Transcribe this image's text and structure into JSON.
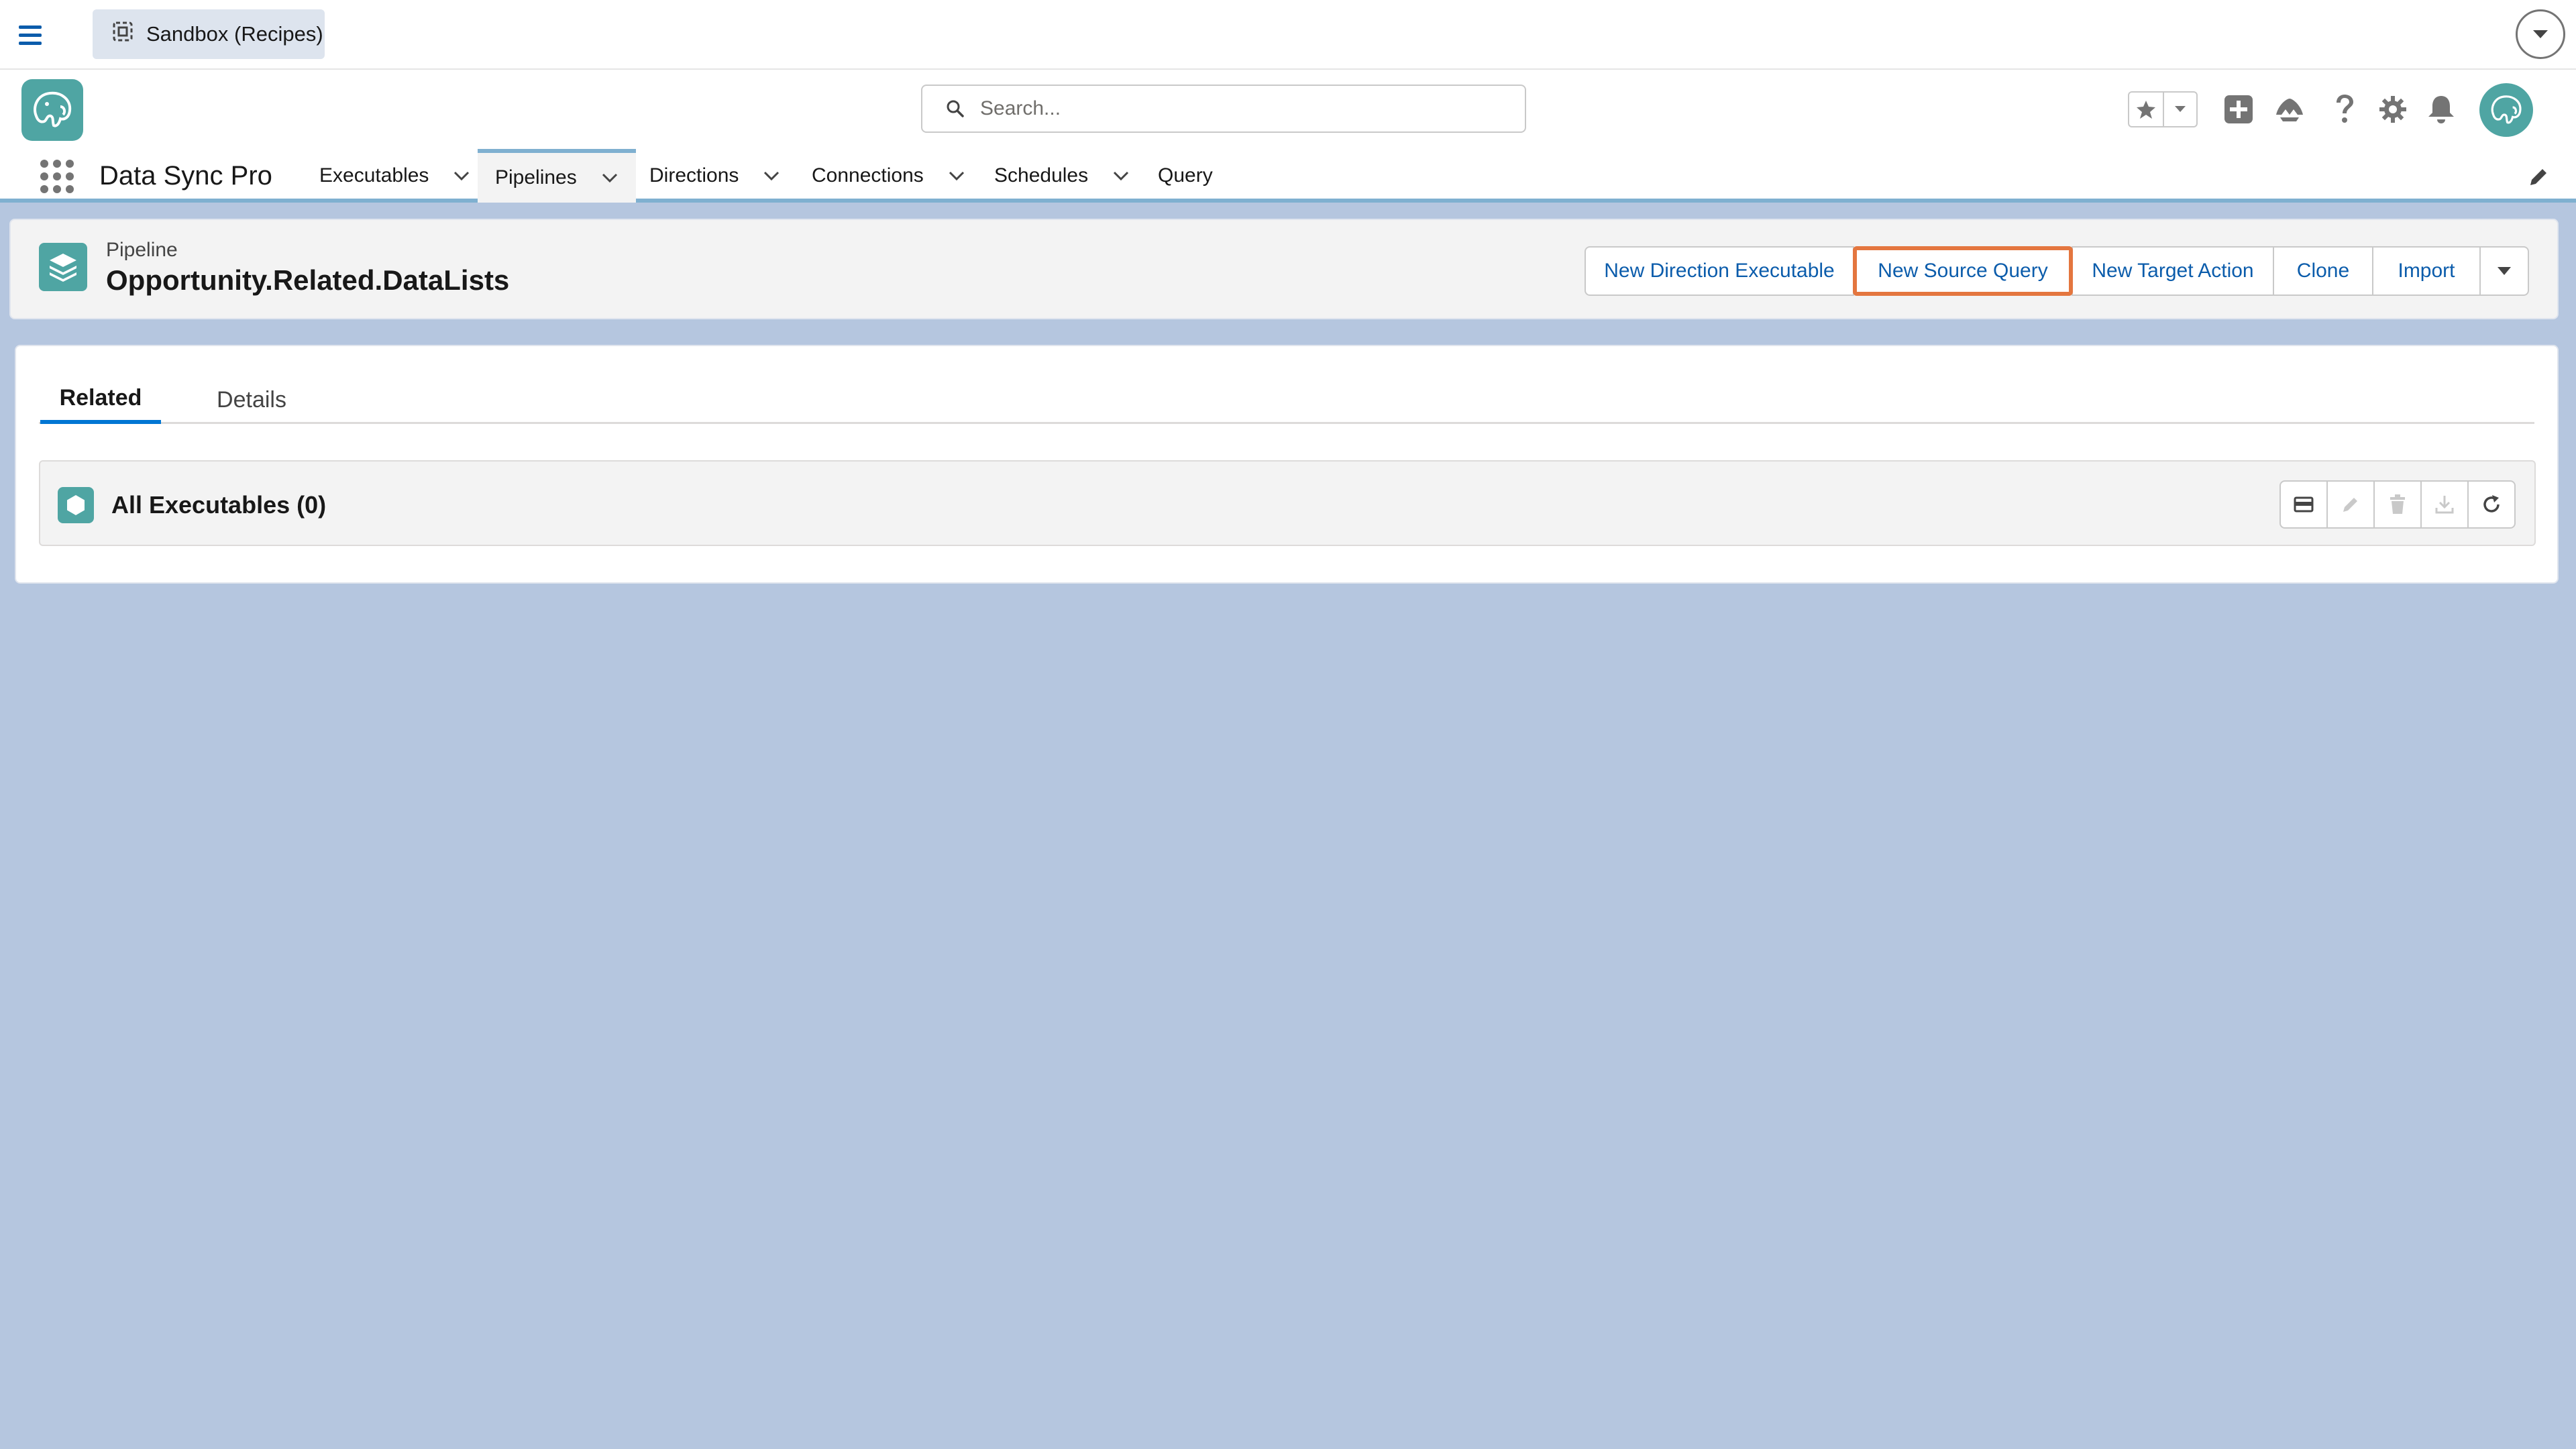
{
  "sandbox": {
    "label": "Sandbox (Recipes)"
  },
  "search": {
    "placeholder": "Search..."
  },
  "app": {
    "name": "Data Sync Pro"
  },
  "nav": {
    "items": [
      {
        "label": "Executables",
        "has_menu": true,
        "active": false
      },
      {
        "label": "Pipelines",
        "has_menu": true,
        "active": true
      },
      {
        "label": "Directions",
        "has_menu": true,
        "active": false
      },
      {
        "label": "Connections",
        "has_menu": true,
        "active": false
      },
      {
        "label": "Schedules",
        "has_menu": true,
        "active": false
      },
      {
        "label": "Query",
        "has_menu": false,
        "active": false
      }
    ]
  },
  "record": {
    "object_label": "Pipeline",
    "title": "Opportunity.Related.DataLists",
    "actions": [
      "New Direction Executable",
      "New Source Query",
      "New Target Action",
      "Clone",
      "Import"
    ],
    "highlighted_action": "New Source Query"
  },
  "tabs": {
    "related": "Related",
    "details": "Details",
    "active": "Related"
  },
  "related_list": {
    "title": "All Executables (0)"
  },
  "colors": {
    "page_background": "#b5c6df",
    "brand_teal": "#4fa5a3",
    "link_blue": "#0b5cab",
    "tab_active": "#0176d3",
    "highlight_outline": "#e4763f"
  }
}
